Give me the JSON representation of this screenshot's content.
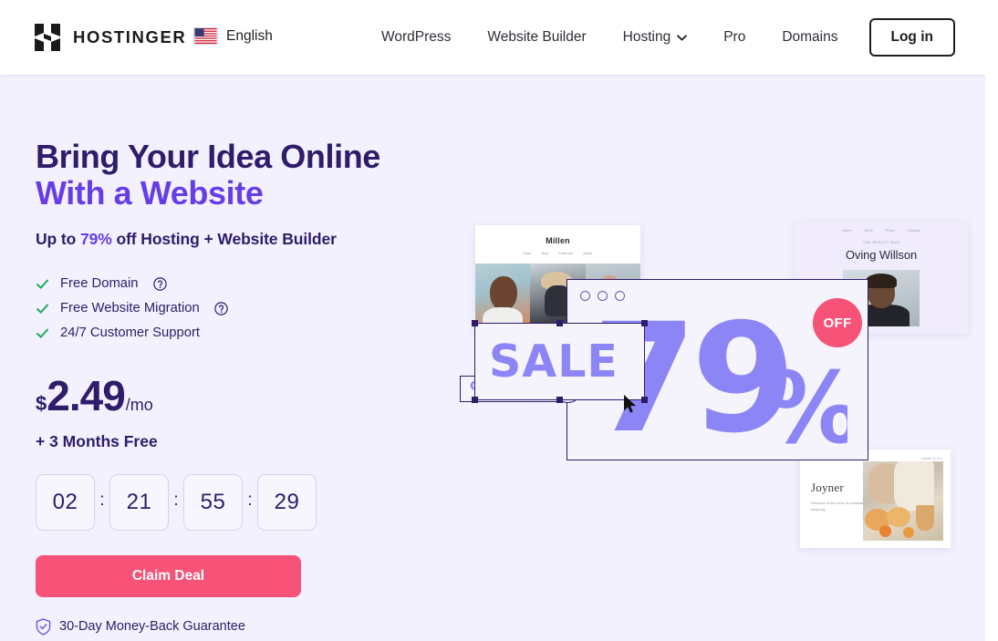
{
  "header": {
    "logo_text": "HOSTINGER",
    "logo_icon": "hostinger-h-logo",
    "language": {
      "label": "English",
      "flag_icon": "us-flag-icon"
    },
    "nav_items": [
      {
        "label": "WordPress",
        "has_chevron": false
      },
      {
        "label": "Website Builder",
        "has_chevron": false
      },
      {
        "label": "Hosting",
        "has_chevron": true
      },
      {
        "label": "Pro",
        "has_chevron": false
      },
      {
        "label": "Domains",
        "has_chevron": false
      }
    ],
    "login_label": "Log in"
  },
  "hero": {
    "headline_line1": "Bring Your Idea Online",
    "headline_line2": "With a Website",
    "subhead_prefix": "Up to ",
    "subhead_highlight": "79%",
    "subhead_suffix": " off Hosting + Website Builder",
    "features": [
      {
        "label": "Free Domain",
        "has_help": true
      },
      {
        "label": "Free Website Migration",
        "has_help": true
      },
      {
        "label": "24/7 Customer Support",
        "has_help": false
      }
    ],
    "price": {
      "currency": "$",
      "amount": "2.49",
      "period": "/mo",
      "bonus": "+ 3 Months Free"
    },
    "countdown": {
      "separator": ":",
      "units": [
        "02",
        "21",
        "55",
        "29"
      ]
    },
    "cta_label": "Claim Deal",
    "guarantee_label": "30-Day Money-Back Guarantee",
    "guarantee_icon": "shield-check-icon"
  },
  "collage": {
    "millen_card": {
      "title": "Millen",
      "nav": [
        "Shop",
        "New",
        "Features",
        "About"
      ]
    },
    "oving_card": {
      "kicker": "THE BEAUTY MAN",
      "title": "Oving Willson",
      "nav": [
        "Home",
        "Work",
        "Press",
        "Contact"
      ]
    },
    "joyner_card": {
      "title": "Joyner",
      "subtitle": "Welcome to the home of sustainable shopping.",
      "logo": "Joyner & Co."
    },
    "browser": {
      "discount_number": "79",
      "discount_symbol": "%",
      "badge_label": "OFF"
    },
    "percent_widget": {
      "glyphs": [
        "%",
        "%",
        "%",
        "%",
        "%"
      ],
      "arrow_icon": "arrow-right-icon"
    },
    "sale_element": {
      "text": "SALE",
      "cursor_icon": "mouse-pointer-icon"
    }
  },
  "colors": {
    "brand_purple": "#673de6",
    "deep_navy": "#2f1c6a",
    "accent_pink": "#f75277",
    "periwinkle": "#8c85f5",
    "check_green": "#27ae60",
    "hero_bg": "#f2f1fd"
  }
}
